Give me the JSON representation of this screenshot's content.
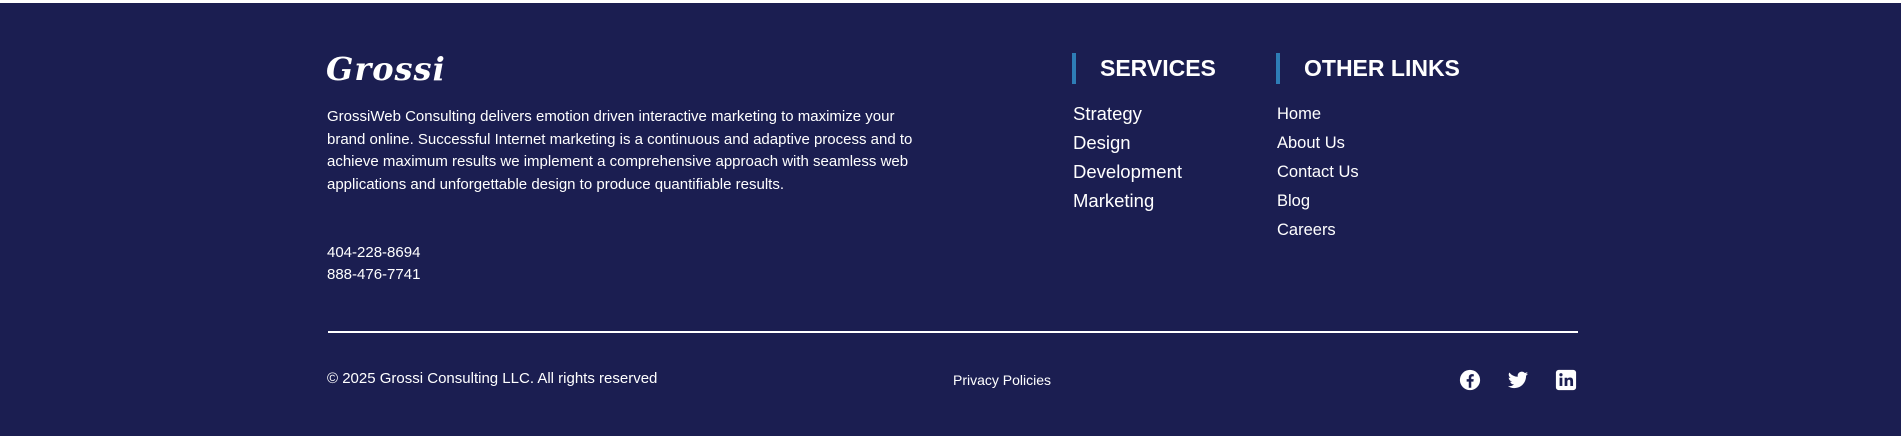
{
  "brand": {
    "logo_text": "Grossi",
    "description": "GrossiWeb Consulting delivers emotion driven interactive marketing to maximize your brand online. Successful Internet marketing is a continuous and adaptive process and to achieve maximum results we implement a comprehensive approach with seamless web applications and unforgettable design to produce quantifiable results.",
    "phones": [
      "404-228-8694",
      "888-476-7741"
    ]
  },
  "services": {
    "heading": "SERVICES",
    "items": [
      "Strategy",
      "Design",
      "Development",
      "Marketing"
    ]
  },
  "other_links": {
    "heading": "OTHER LINKS",
    "items": [
      "Home",
      "About Us",
      "Contact Us",
      "Blog",
      "Careers"
    ]
  },
  "bottom": {
    "copyright": "© 2025 Grossi Consulting LLC. All rights reserved",
    "privacy": "Privacy Policies"
  },
  "social": [
    "facebook-icon",
    "twitter-icon",
    "linkedin-icon"
  ],
  "colors": {
    "background": "#1b1e51",
    "accent_bar": "#2e7db6",
    "text": "#ffffff"
  }
}
